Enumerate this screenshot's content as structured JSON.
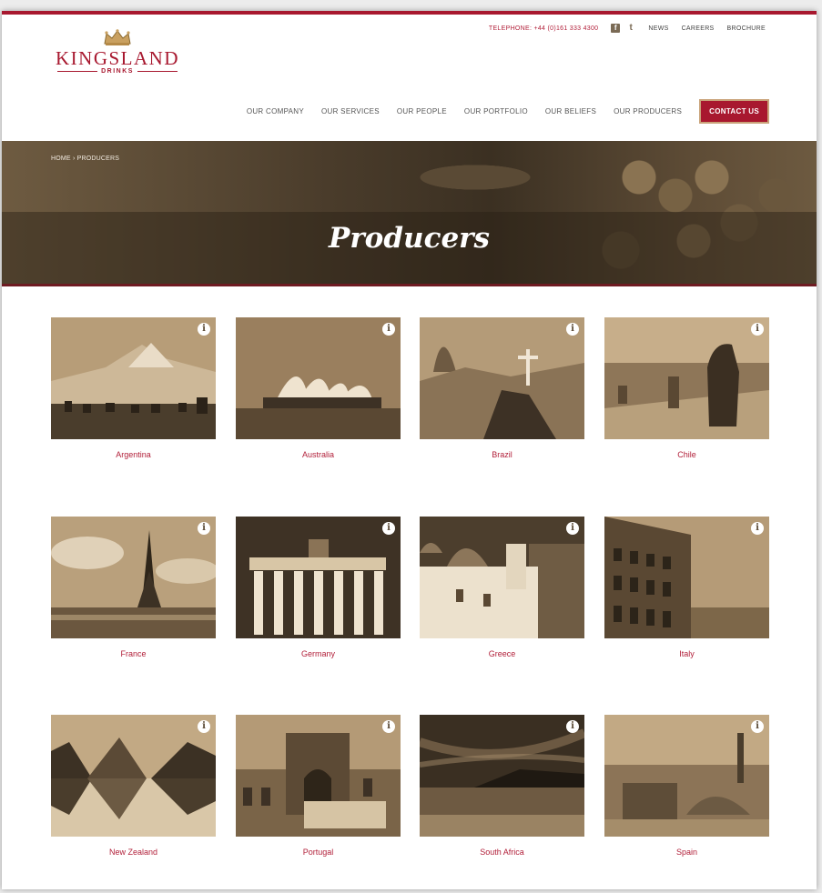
{
  "header": {
    "telephone": "TELEPHONE: +44 (0)161 333 4300",
    "social": [
      {
        "icon": "facebook-icon",
        "glyph": "f"
      },
      {
        "icon": "twitter-icon",
        "glyph": "t"
      }
    ],
    "top_links": [
      "NEWS",
      "CAREERS",
      "BROCHURE"
    ],
    "logo": {
      "main": "KINGSLAND",
      "sub": "DRINKS"
    },
    "nav": [
      "OUR COMPANY",
      "OUR SERVICES",
      "OUR PEOPLE",
      "OUR PORTFOLIO",
      "OUR BELIEFS",
      "OUR PRODUCERS"
    ],
    "contact": "CONTACT US"
  },
  "hero": {
    "breadcrumb": "HOME › PRODUCERS",
    "title": "Producers"
  },
  "producers": [
    {
      "label": "Argentina",
      "info_icon": "i"
    },
    {
      "label": "Australia",
      "info_icon": "i"
    },
    {
      "label": "Brazil",
      "info_icon": "i"
    },
    {
      "label": "Chile",
      "info_icon": "i"
    },
    {
      "label": "France",
      "info_icon": "i"
    },
    {
      "label": "Germany",
      "info_icon": "i"
    },
    {
      "label": "Greece",
      "info_icon": "i"
    },
    {
      "label": "Italy",
      "info_icon": "i"
    },
    {
      "label": "New Zealand",
      "info_icon": "i"
    },
    {
      "label": "Portugal",
      "info_icon": "i"
    },
    {
      "label": "South Africa",
      "info_icon": "i"
    },
    {
      "label": "Spain",
      "info_icon": "i"
    }
  ],
  "colors": {
    "accent": "#a8182f",
    "sepia_light": "#c9b08a",
    "sepia_dark": "#3e3225"
  }
}
